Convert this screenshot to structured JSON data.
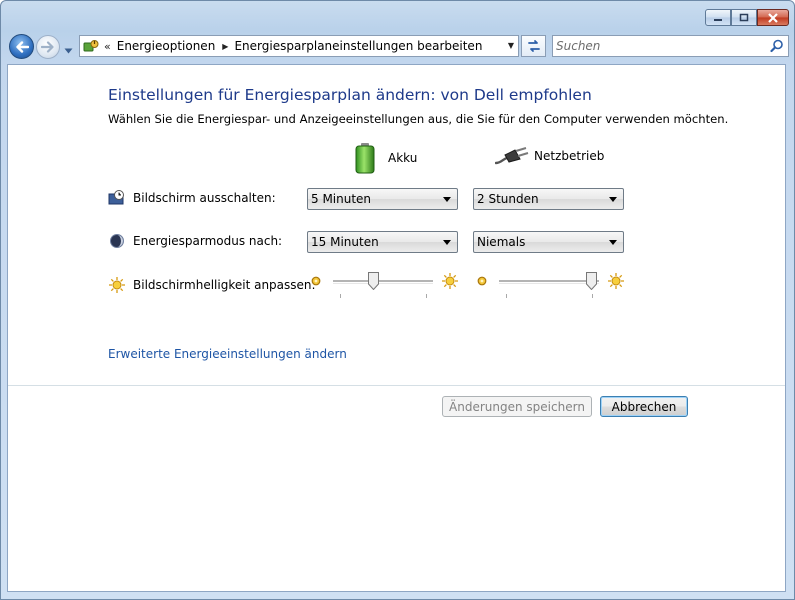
{
  "window": {
    "min_label": "minimize",
    "max_label": "maximize",
    "close_label": "close"
  },
  "nav": {
    "breadcrumb_overflow": "«",
    "crumbs": [
      "Energieoptionen",
      "Energiesparplaneinstellungen bearbeiten"
    ],
    "search_placeholder": "Suchen"
  },
  "main": {
    "title": "Einstellungen für Energiesparplan ändern: von Dell empfohlen",
    "subtitle": "Wählen Sie die Energiespar- und Anzeigeeinstellungen aus, die Sie für den Computer verwenden möchten.",
    "columns": {
      "battery": "Akku",
      "plugged": "Netzbetrieb"
    },
    "rows": {
      "display_off": {
        "label": "Bildschirm ausschalten:",
        "battery": "5 Minuten",
        "plugged": "2 Stunden"
      },
      "sleep": {
        "label": "Energiesparmodus nach:",
        "battery": "15 Minuten",
        "plugged": "Niemals"
      },
      "brightness": {
        "label": "Bildschirmhelligkeit anpassen:",
        "battery_level": 0.4,
        "plugged_level": 1.0
      }
    },
    "advanced_link": "Erweiterte Energieeinstellungen ändern"
  },
  "footer": {
    "save_label": "Änderungen speichern",
    "cancel_label": "Abbrechen"
  },
  "icons": {
    "back": "back-arrow-icon",
    "forward": "forward-arrow-icon",
    "power_options": "power-options-icon",
    "refresh": "refresh-icon",
    "search": "magnifier-icon",
    "battery": "battery-icon",
    "plug": "plug-icon",
    "monitor_clock": "monitor-clock-icon",
    "moon": "moon-icon",
    "sun": "sun-icon"
  },
  "colors": {
    "title": "#1e3a8a",
    "link": "#1e55a5",
    "chrome": "#c9dcef"
  }
}
